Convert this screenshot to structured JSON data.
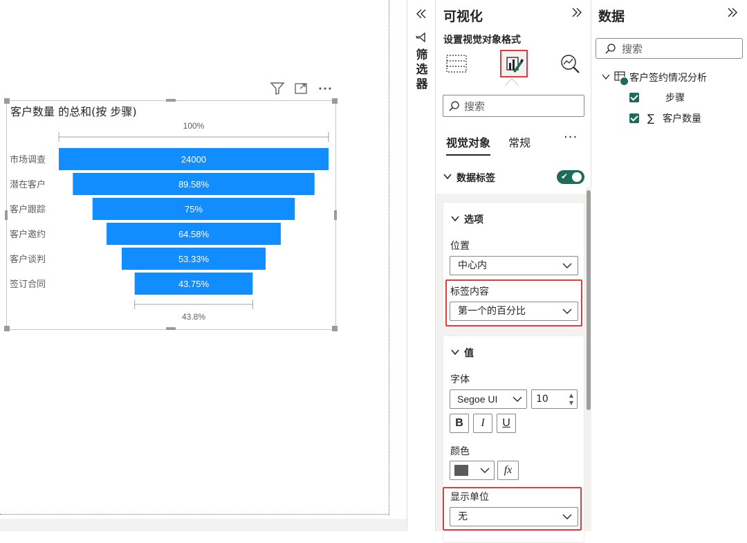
{
  "filter_pane": {
    "collapse_icon": "double-chevron-left-icon",
    "label": "筛选器"
  },
  "visualizations_pane": {
    "title": "可视化",
    "subtitle": "设置视觉对象格式",
    "modes": [
      "build-visual-icon",
      "format-visual-icon",
      "analytics-icon"
    ],
    "search_placeholder": "搜索",
    "tabs": [
      {
        "label": "视觉对象",
        "active": true
      },
      {
        "label": "常规",
        "active": false
      }
    ],
    "more_label": "···",
    "data_labels": {
      "title": "数据标签",
      "enabled": true
    },
    "options_card": {
      "title": "选项",
      "position_label": "位置",
      "position_value": "中心内",
      "label_content_label": "标签内容",
      "label_content_value": "第一个的百分比"
    },
    "values_card": {
      "title": "值",
      "font_label": "字体",
      "font_value": "Segoe UI",
      "font_size": "10",
      "bold_label": "B",
      "italic_label": "I",
      "underline_label": "U",
      "color_label": "颜色",
      "color_value": "#5a5a5a",
      "fx_label": "fx",
      "display_units_label": "显示单位",
      "display_units_value": "无"
    }
  },
  "data_pane": {
    "title": "数据",
    "search_placeholder": "搜索",
    "table_name": "客户签约情况分析",
    "fields": [
      {
        "name": "步骤",
        "checked": true,
        "sigma": false
      },
      {
        "name": "客户数量",
        "checked": true,
        "sigma": true
      }
    ]
  },
  "colors": {
    "funnel_bar": "#118dff",
    "accent_green": "#1e6b5b",
    "highlight_red": "#e23b3b"
  },
  "chart_data": {
    "type": "funnel",
    "title": "客户数量 的总和(按 步骤)",
    "categories": [
      "市场调查",
      "潜在客户",
      "客户跟踪",
      "客户邀约",
      "客户谈判",
      "签订合同"
    ],
    "values": [
      24000,
      21500,
      18000,
      15500,
      12800,
      10500
    ],
    "bar_labels": [
      "24000",
      "89.58%",
      "75%",
      "64.58%",
      "53.33%",
      "43.75%"
    ],
    "top_percent_label": "100%",
    "bottom_percent_label": "43.8%"
  }
}
